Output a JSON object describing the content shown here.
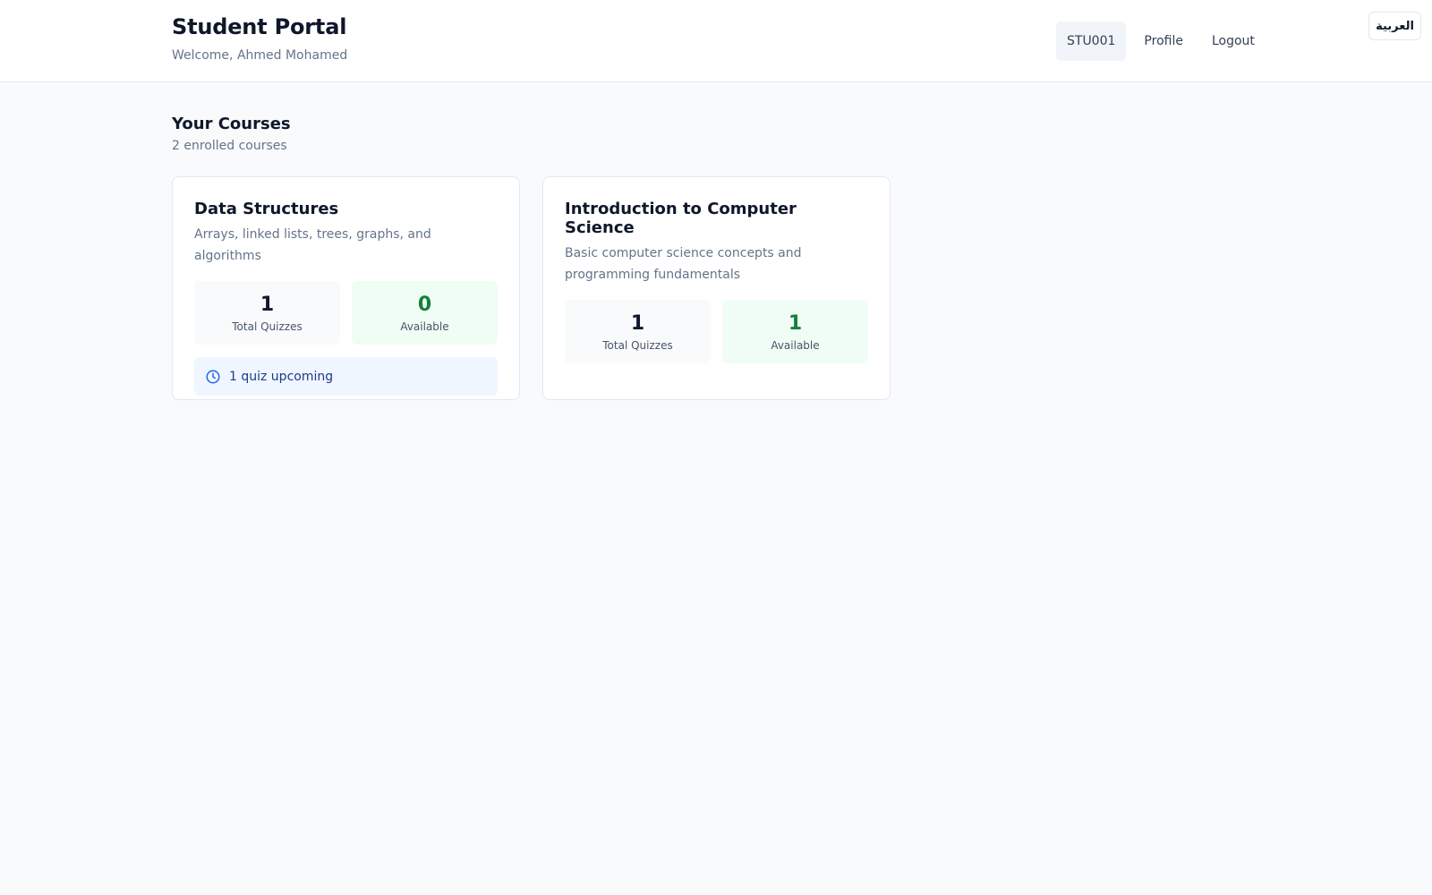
{
  "header": {
    "title": "Student Portal",
    "welcome": "Welcome, Ahmed Mohamed",
    "student_id": "STU001",
    "profile_label": "Profile",
    "logout_label": "Logout",
    "language_label": "العربية"
  },
  "courses_section": {
    "title": "Your Courses",
    "subtitle": "2 enrolled courses"
  },
  "courses": [
    {
      "title": "Data Structures",
      "description": "Arrays, linked lists, trees, graphs, and algorithms",
      "total_quizzes": "1",
      "total_label": "Total Quizzes",
      "available": "0",
      "available_label": "Available",
      "notice": "1 quiz upcoming"
    },
    {
      "title": "Introduction to Computer Science",
      "description": "Basic computer science concepts and programming fundamentals",
      "total_quizzes": "1",
      "total_label": "Total Quizzes",
      "available": "1",
      "available_label": "Available"
    }
  ],
  "colors": {
    "background": "#f8fafc",
    "available_accent": "#15803d",
    "notice_bg": "#eff6ff",
    "notice_text": "#1e3a8a"
  },
  "icons": {
    "notice_icon": "clock-icon"
  }
}
